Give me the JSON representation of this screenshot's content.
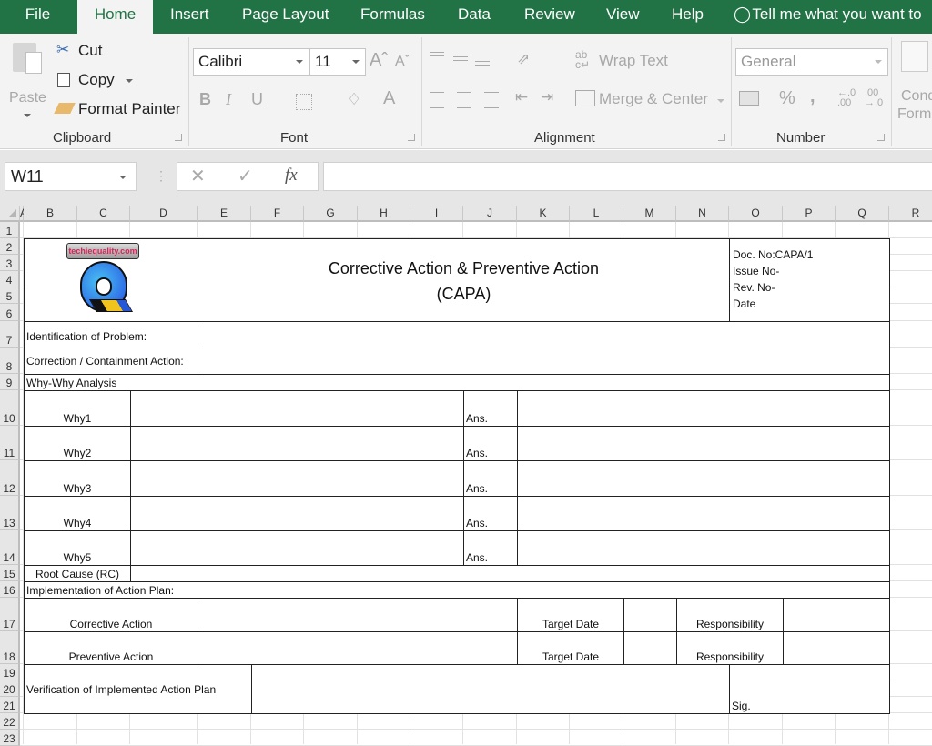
{
  "ribbon_tabs": [
    {
      "label": "File"
    },
    {
      "label": "Home",
      "active": true
    },
    {
      "label": "Insert"
    },
    {
      "label": "Page Layout"
    },
    {
      "label": "Formulas"
    },
    {
      "label": "Data"
    },
    {
      "label": "Review"
    },
    {
      "label": "View"
    },
    {
      "label": "Help"
    }
  ],
  "tell_me": "Tell me what you want to",
  "clipboard": {
    "paste": "Paste",
    "cut": "Cut",
    "copy": "Copy",
    "format_painter": "Format Painter",
    "group": "Clipboard"
  },
  "font": {
    "name": "Calibri",
    "size": "11",
    "bold": "B",
    "italic": "I",
    "underline": "U",
    "group": "Font"
  },
  "alignment": {
    "wrap_text": "Wrap Text",
    "merge_center": "Merge & Center",
    "group": "Alignment"
  },
  "number": {
    "format": "General",
    "percent": "%",
    "comma": ",",
    "group": "Number"
  },
  "styles": {
    "conditional_formatting_line1": "Cond",
    "conditional_formatting_line2": "Form"
  },
  "formula_bar": {
    "name_box": "W11",
    "cancel": "✕",
    "enter": "✓",
    "fx": "fx",
    "value": ""
  },
  "columns": [
    "A",
    "B",
    "C",
    "D",
    "E",
    "F",
    "G",
    "H",
    "I",
    "J",
    "K",
    "L",
    "M",
    "N",
    "O",
    "P",
    "Q",
    "R"
  ],
  "rows": [
    "1",
    "2",
    "3",
    "4",
    "5",
    "6",
    "7",
    "8",
    "9",
    "10",
    "11",
    "12",
    "13",
    "14",
    "15",
    "16",
    "17",
    "18",
    "19",
    "20",
    "21",
    "22",
    "23"
  ],
  "form": {
    "logo_text": "techiequality.com",
    "title_line1": "Corrective Action & Preventive Action",
    "title_line2": "(CAPA)",
    "doc_no": "Doc. No:CAPA/1",
    "issue_no": "Issue No-",
    "rev_no": "Rev. No-",
    "date": "Date",
    "identification": "Identification of Problem:",
    "correction": "Correction / Containment Action:",
    "why_why": "Why-Why Analysis",
    "whys": [
      "Why1",
      "Why2",
      "Why3",
      "Why4",
      "Why5"
    ],
    "ans": "Ans.",
    "root_cause": "Root Cause (RC)",
    "implementation": "Implementation of Action Plan:",
    "corrective_action": "Corrective Action",
    "preventive_action": "Preventive Action",
    "target_date": "Target Date",
    "responsibility": "Responsibility",
    "verification": "Verification of Implemented Action Plan",
    "sig": "Sig."
  }
}
